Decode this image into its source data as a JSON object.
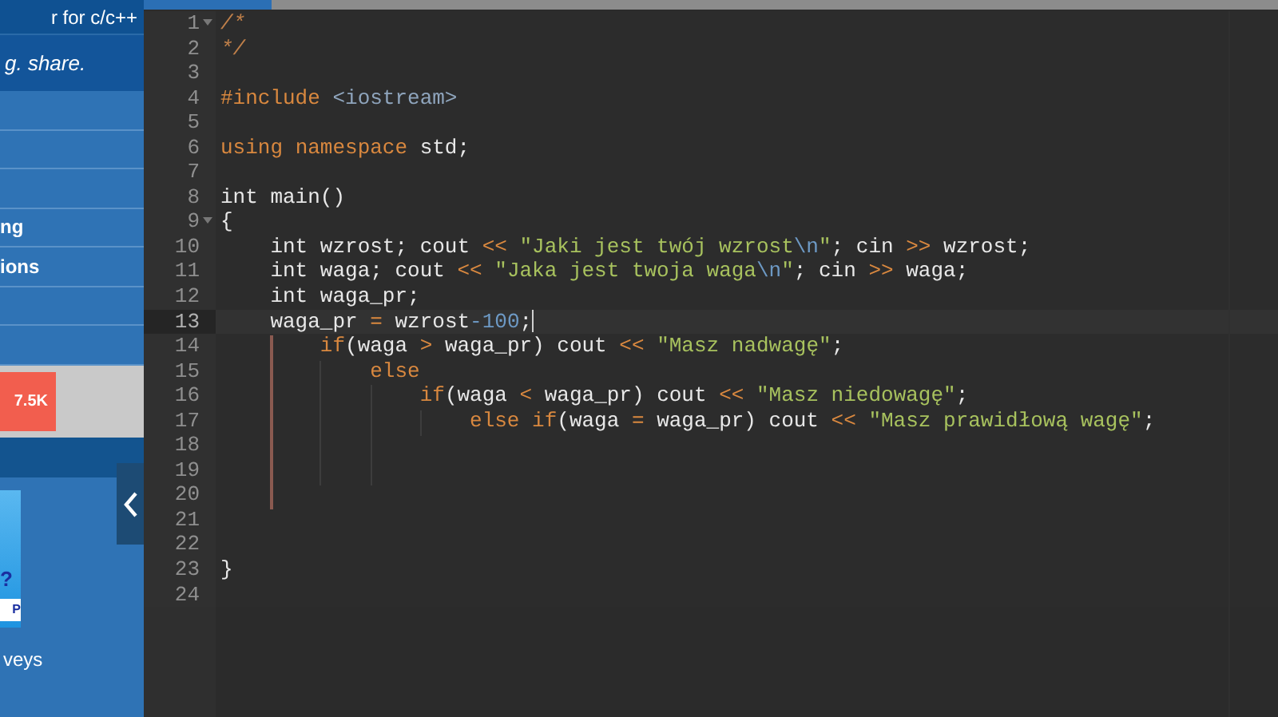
{
  "sidebar": {
    "tagline": "r for c/c++",
    "motto": "g. share.",
    "menu": [
      {
        "label": "ng"
      },
      {
        "label": "ions"
      }
    ],
    "counter_button": "7.5K",
    "ad": {
      "mark": "?",
      "button": "P"
    },
    "footer_text": "veys"
  },
  "editor": {
    "lines": [
      {
        "number": "1",
        "fold": true,
        "active": false,
        "tokens": [
          {
            "kind": "comment",
            "text": "/*"
          }
        ]
      },
      {
        "number": "2",
        "fold": false,
        "active": false,
        "tokens": [
          {
            "kind": "comment",
            "text": "*/"
          }
        ]
      },
      {
        "number": "3",
        "fold": false,
        "active": false
      },
      {
        "number": "4",
        "fold": false,
        "active": false,
        "tokens": [
          {
            "kind": "keyword",
            "text": "#include"
          },
          {
            "kind": "include",
            "text": " <iostream>"
          }
        ]
      },
      {
        "number": "5",
        "fold": false,
        "active": false
      },
      {
        "number": "6",
        "fold": false,
        "active": false,
        "tokens": [
          {
            "kind": "keyword",
            "text": "using"
          },
          {
            "kind": "keyword",
            "text": " namespace"
          },
          {
            "kind": "plain",
            "text": " std;"
          }
        ]
      },
      {
        "number": "7",
        "fold": false,
        "active": false
      },
      {
        "number": "8",
        "fold": false,
        "active": false,
        "tokens": [
          {
            "kind": "plain",
            "text": "int main()"
          }
        ]
      },
      {
        "number": "9",
        "fold": true,
        "active": false,
        "tokens": [
          {
            "kind": "plain",
            "text": "{"
          }
        ]
      },
      {
        "number": "10",
        "fold": false,
        "active": false,
        "tokens": [
          {
            "kind": "plain",
            "text": "    int wzrost; cout "
          },
          {
            "kind": "operator",
            "text": "<<"
          },
          {
            "kind": "string",
            "text": " \"Jaki jest twój wzrost"
          },
          {
            "kind": "escape",
            "text": "\\n"
          },
          {
            "kind": "string",
            "text": "\""
          },
          {
            "kind": "plain",
            "text": "; cin "
          },
          {
            "kind": "operator",
            "text": ">>"
          },
          {
            "kind": "plain",
            "text": " wzrost;"
          }
        ]
      },
      {
        "number": "11",
        "fold": false,
        "active": false,
        "tokens": [
          {
            "kind": "plain",
            "text": "    int waga; cout "
          },
          {
            "kind": "operator",
            "text": "<<"
          },
          {
            "kind": "string",
            "text": " \"Jaka jest twoja waga"
          },
          {
            "kind": "escape",
            "text": "\\n"
          },
          {
            "kind": "string",
            "text": "\""
          },
          {
            "kind": "plain",
            "text": "; cin "
          },
          {
            "kind": "operator",
            "text": ">>"
          },
          {
            "kind": "plain",
            "text": " waga;"
          }
        ]
      },
      {
        "number": "12",
        "fold": false,
        "active": false,
        "tokens": [
          {
            "kind": "plain",
            "text": "    int waga_pr;"
          }
        ]
      },
      {
        "number": "13",
        "fold": false,
        "active": true,
        "tokens": [
          {
            "kind": "plain",
            "text": "    waga_pr "
          },
          {
            "kind": "operator",
            "text": "="
          },
          {
            "kind": "plain",
            "text": " wzrost"
          },
          {
            "kind": "number",
            "text": "-100"
          },
          {
            "kind": "plain",
            "text": ";"
          }
        ]
      },
      {
        "number": "14",
        "fold": false,
        "active": false,
        "tokens": [
          {
            "kind": "keyword",
            "text": "        if"
          },
          {
            "kind": "plain",
            "text": "(waga "
          },
          {
            "kind": "operator",
            "text": ">"
          },
          {
            "kind": "plain",
            "text": " waga_pr) cout "
          },
          {
            "kind": "operator",
            "text": "<<"
          },
          {
            "kind": "string",
            "text": " \"Masz nadwagę\""
          },
          {
            "kind": "plain",
            "text": ";"
          }
        ]
      },
      {
        "number": "15",
        "fold": false,
        "active": false,
        "tokens": [
          {
            "kind": "keyword",
            "text": "            else"
          }
        ]
      },
      {
        "number": "16",
        "fold": false,
        "active": false,
        "tokens": [
          {
            "kind": "keyword",
            "text": "                if"
          },
          {
            "kind": "plain",
            "text": "(waga "
          },
          {
            "kind": "operator",
            "text": "<"
          },
          {
            "kind": "plain",
            "text": " waga_pr) cout "
          },
          {
            "kind": "operator",
            "text": "<<"
          },
          {
            "kind": "string",
            "text": " \"Masz niedowagę\""
          },
          {
            "kind": "plain",
            "text": ";"
          }
        ]
      },
      {
        "number": "17",
        "fold": false,
        "active": false,
        "tokens": [
          {
            "kind": "keyword",
            "text": "                    else if"
          },
          {
            "kind": "plain",
            "text": "(waga "
          },
          {
            "kind": "operator",
            "text": "="
          },
          {
            "kind": "plain",
            "text": " waga_pr) cout "
          },
          {
            "kind": "operator",
            "text": "<<"
          },
          {
            "kind": "string",
            "text": " \"Masz prawidłową wagę\""
          },
          {
            "kind": "plain",
            "text": ";"
          }
        ]
      },
      {
        "number": "18",
        "fold": false,
        "active": false
      },
      {
        "number": "19",
        "fold": false,
        "active": false
      },
      {
        "number": "20",
        "fold": false,
        "active": false
      },
      {
        "number": "21",
        "fold": false,
        "active": false
      },
      {
        "number": "22",
        "fold": false,
        "active": false
      },
      {
        "number": "23",
        "fold": false,
        "active": false,
        "tokens": [
          {
            "kind": "plain",
            "text": "}"
          }
        ]
      },
      {
        "number": "24",
        "fold": false,
        "active": false
      }
    ]
  }
}
